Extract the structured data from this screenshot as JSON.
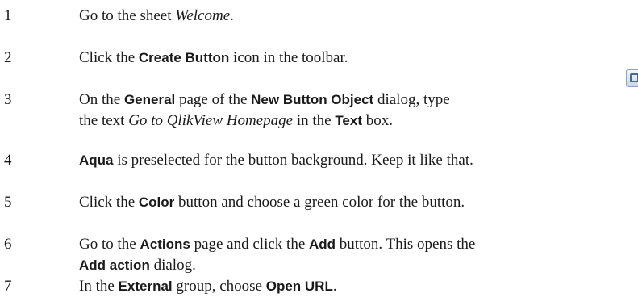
{
  "steps": [
    {
      "number": "1",
      "lines": [
        [
          {
            "t": "Go to the sheet ",
            "s": "plain"
          },
          {
            "t": "Welcome",
            "s": "em"
          },
          {
            "t": ".",
            "s": "plain"
          }
        ]
      ]
    },
    {
      "number": "2",
      "lines": [
        [
          {
            "t": "Click the ",
            "s": "plain"
          },
          {
            "t": "Create Button",
            "s": "ui"
          },
          {
            "t": " icon in the toolbar.",
            "s": "plain"
          }
        ]
      ]
    },
    {
      "number": "3",
      "lines": [
        [
          {
            "t": "On the ",
            "s": "plain"
          },
          {
            "t": "General",
            "s": "ui"
          },
          {
            "t": " page of the ",
            "s": "plain"
          },
          {
            "t": "New Button Object",
            "s": "ui"
          },
          {
            "t": " dialog, type",
            "s": "plain"
          }
        ],
        [
          {
            "t": "the text ",
            "s": "plain"
          },
          {
            "t": "Go to QlikView Homepage",
            "s": "em"
          },
          {
            "t": " in the ",
            "s": "plain"
          },
          {
            "t": "Text",
            "s": "ui"
          },
          {
            "t": " box.",
            "s": "plain"
          }
        ]
      ]
    },
    {
      "number": "4",
      "lines": [
        [
          {
            "t": "Aqua",
            "s": "ui"
          },
          {
            "t": " is preselected for the button background. Keep it like that.",
            "s": "plain"
          }
        ]
      ]
    },
    {
      "number": "5",
      "lines": [
        [
          {
            "t": "Click the ",
            "s": "plain"
          },
          {
            "t": "Color",
            "s": "ui"
          },
          {
            "t": " button and choose a green color for the button.",
            "s": "plain"
          }
        ]
      ]
    },
    {
      "number": "6",
      "lines": [
        [
          {
            "t": "Go to the ",
            "s": "plain"
          },
          {
            "t": "Actions",
            "s": "ui"
          },
          {
            "t": " page and click the ",
            "s": "plain"
          },
          {
            "t": "Add",
            "s": "ui"
          },
          {
            "t": " button. This opens the",
            "s": "plain"
          }
        ],
        [
          {
            "t": "Add action",
            "s": "ui"
          },
          {
            "t": " dialog.",
            "s": "plain"
          }
        ]
      ]
    },
    {
      "number": "7",
      "lines": [
        [
          {
            "t": "In the ",
            "s": "plain"
          },
          {
            "t": "External",
            "s": "ui"
          },
          {
            "t": " group, choose ",
            "s": "plain"
          },
          {
            "t": "Open URL",
            "s": "ui"
          },
          {
            "t": ".",
            "s": "plain"
          }
        ]
      ]
    }
  ],
  "toolbar_icon": {
    "icon": "create-button-icon"
  }
}
